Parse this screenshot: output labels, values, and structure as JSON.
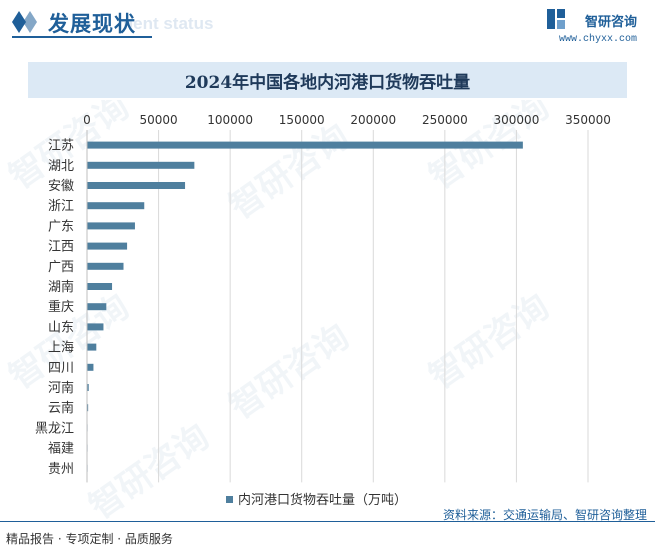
{
  "header": {
    "title": "发展现状",
    "subtitle": "ment status",
    "brand_name": "智研咨询",
    "brand_url": "www.chyxx.com"
  },
  "chart_data": {
    "type": "bar",
    "orientation": "horizontal",
    "title": "2024年中国各地内河港口货物吞吐量",
    "categories": [
      "江苏",
      "湖北",
      "安徽",
      "浙江",
      "广东",
      "江西",
      "广西",
      "湖南",
      "重庆",
      "山东",
      "上海",
      "四川",
      "河南",
      "云南",
      "黑龙江",
      "福建",
      "贵州"
    ],
    "series": [
      {
        "name": "内河港口货物吞吐量（万吨）",
        "values": [
          304500,
          75000,
          68500,
          40000,
          33500,
          28000,
          25500,
          17500,
          13500,
          11500,
          6500,
          4500,
          1200,
          800,
          150,
          80,
          50
        ]
      }
    ],
    "xlim": [
      0,
      350000
    ],
    "xticks": [
      "0",
      "50000",
      "100000",
      "150000",
      "200000",
      "250000",
      "300000",
      "350000"
    ],
    "grid": true,
    "legend_position": "bottom",
    "bar_color": "#4f7f9e"
  },
  "footer": {
    "left": "精品报告 · 专项定制 · 品质服务",
    "right": "资料来源：交通运输局、智研咨询整理"
  },
  "watermark": "智研咨询"
}
